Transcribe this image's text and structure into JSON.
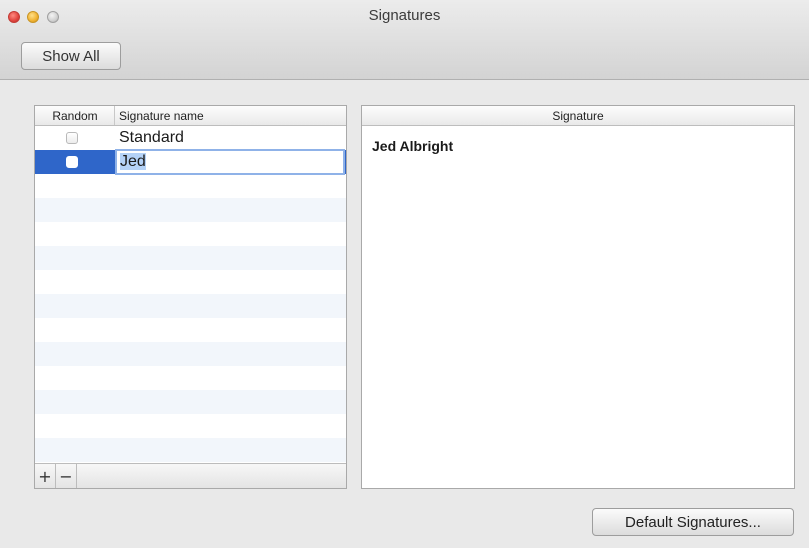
{
  "window": {
    "title": "Signatures",
    "toolbar": {
      "show_all_label": "Show All"
    }
  },
  "signature_list": {
    "columns": {
      "random": "Random",
      "name": "Signature name"
    },
    "rows": [
      {
        "name": "Standard",
        "random_checked": false,
        "selected": false
      },
      {
        "name": "Jed",
        "random_checked": false,
        "selected": true,
        "editing": true
      }
    ],
    "footer": {
      "add_label": "+",
      "remove_label": "−"
    }
  },
  "signature_panel": {
    "header": "Signature",
    "content": "Jed Albright"
  },
  "buttons": {
    "default_signatures_label": "Default Signatures..."
  },
  "colors": {
    "selection": "#2f66c9",
    "edit_highlight": "#b4d2f7"
  }
}
